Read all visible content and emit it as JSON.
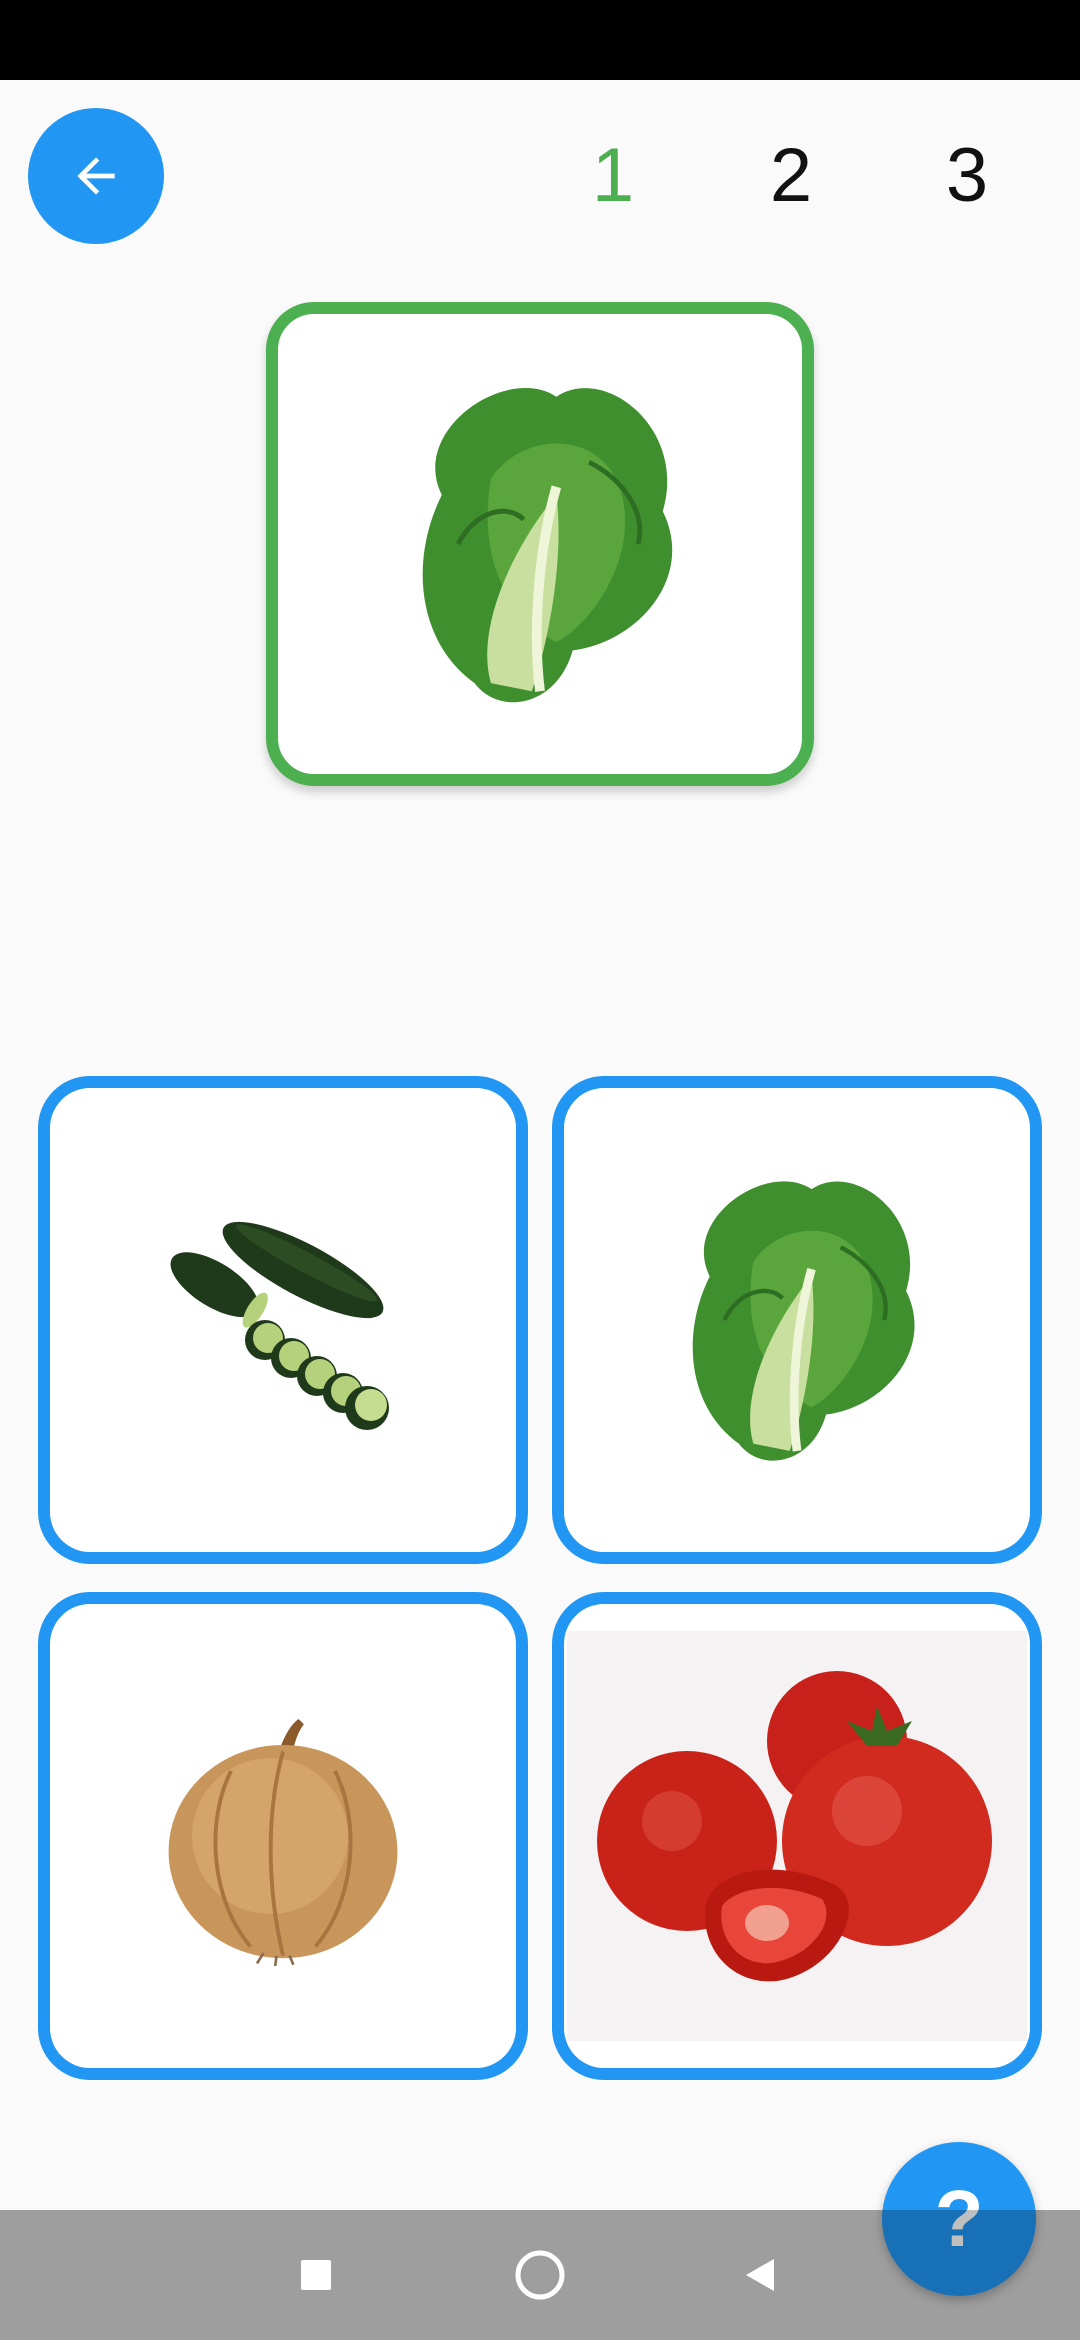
{
  "header": {
    "back_icon": "arrow-left-icon",
    "steps": [
      {
        "label": "1",
        "active": true
      },
      {
        "label": "2",
        "active": false
      },
      {
        "label": "3",
        "active": false
      }
    ]
  },
  "target": {
    "image": "lettuce-image"
  },
  "options": [
    {
      "image": "cucumber-image"
    },
    {
      "image": "lettuce-image"
    },
    {
      "image": "onion-image"
    },
    {
      "image": "tomato-image"
    }
  ],
  "help": {
    "label": "?"
  },
  "colors": {
    "accent": "#2196f3",
    "correct": "#4caf50",
    "nav_bar": "#9e9e9e"
  },
  "nav": {
    "icons": [
      "square-icon",
      "circle-icon",
      "triangle-back-icon"
    ]
  }
}
